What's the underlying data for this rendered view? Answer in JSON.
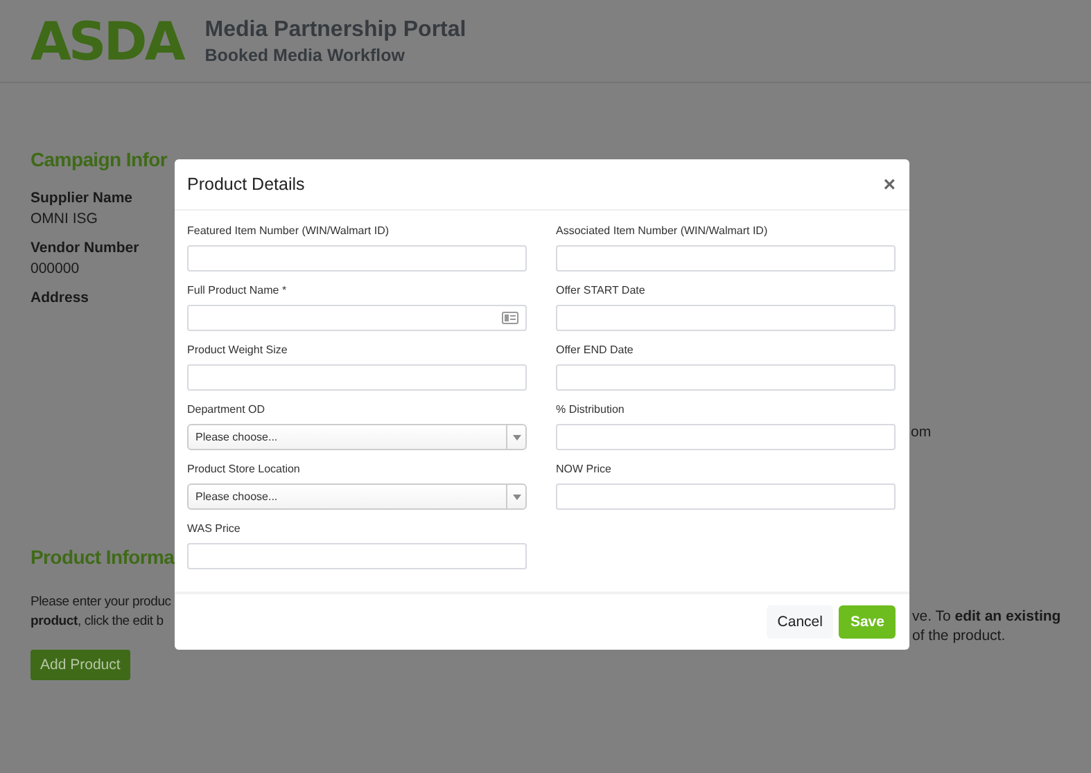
{
  "header": {
    "logo": "ASDA",
    "title": "Media Partnership Portal",
    "subtitle": "Booked Media Workflow"
  },
  "campaign": {
    "heading": "Campaign Infor",
    "fields": [
      {
        "label": "Supplier Name",
        "value": "OMNI ISG"
      },
      {
        "label": "Vendor Number",
        "value": "000000"
      },
      {
        "label": "Address"
      }
    ]
  },
  "right_fragment": "om",
  "product_section": {
    "heading": "Product Informa",
    "intro_left": [
      "Please enter your produc",
      "**product**, click the edit b"
    ],
    "intro_right": [
      "ve. To **edit an existing**",
      "of the product."
    ],
    "add_button": "Add Product"
  },
  "modal": {
    "title": "Product Details",
    "close": "×",
    "left_fields": [
      {
        "label": "Featured Item Number (WIN/Walmart ID)",
        "kind": "text"
      },
      {
        "label": "Full Product Name *",
        "kind": "text-icon"
      },
      {
        "label": "Product Weight Size",
        "kind": "text"
      },
      {
        "label": "Department OD",
        "kind": "select",
        "value": "Please choose..."
      },
      {
        "label": "Product Store Location",
        "kind": "select",
        "value": "Please choose..."
      },
      {
        "label": "WAS Price",
        "kind": "text"
      }
    ],
    "right_fields": [
      {
        "label": "Associated Item Number (WIN/Walmart ID)",
        "kind": "text"
      },
      {
        "label": "Offer START Date",
        "kind": "text"
      },
      {
        "label": "Offer END Date",
        "kind": "text"
      },
      {
        "label": "% Distribution",
        "kind": "text"
      },
      {
        "label": "NOW Price",
        "kind": "text"
      }
    ],
    "buttons": [
      {
        "label": "Cancel",
        "kind": "secondary"
      },
      {
        "label": "Save",
        "kind": "primary"
      }
    ]
  }
}
